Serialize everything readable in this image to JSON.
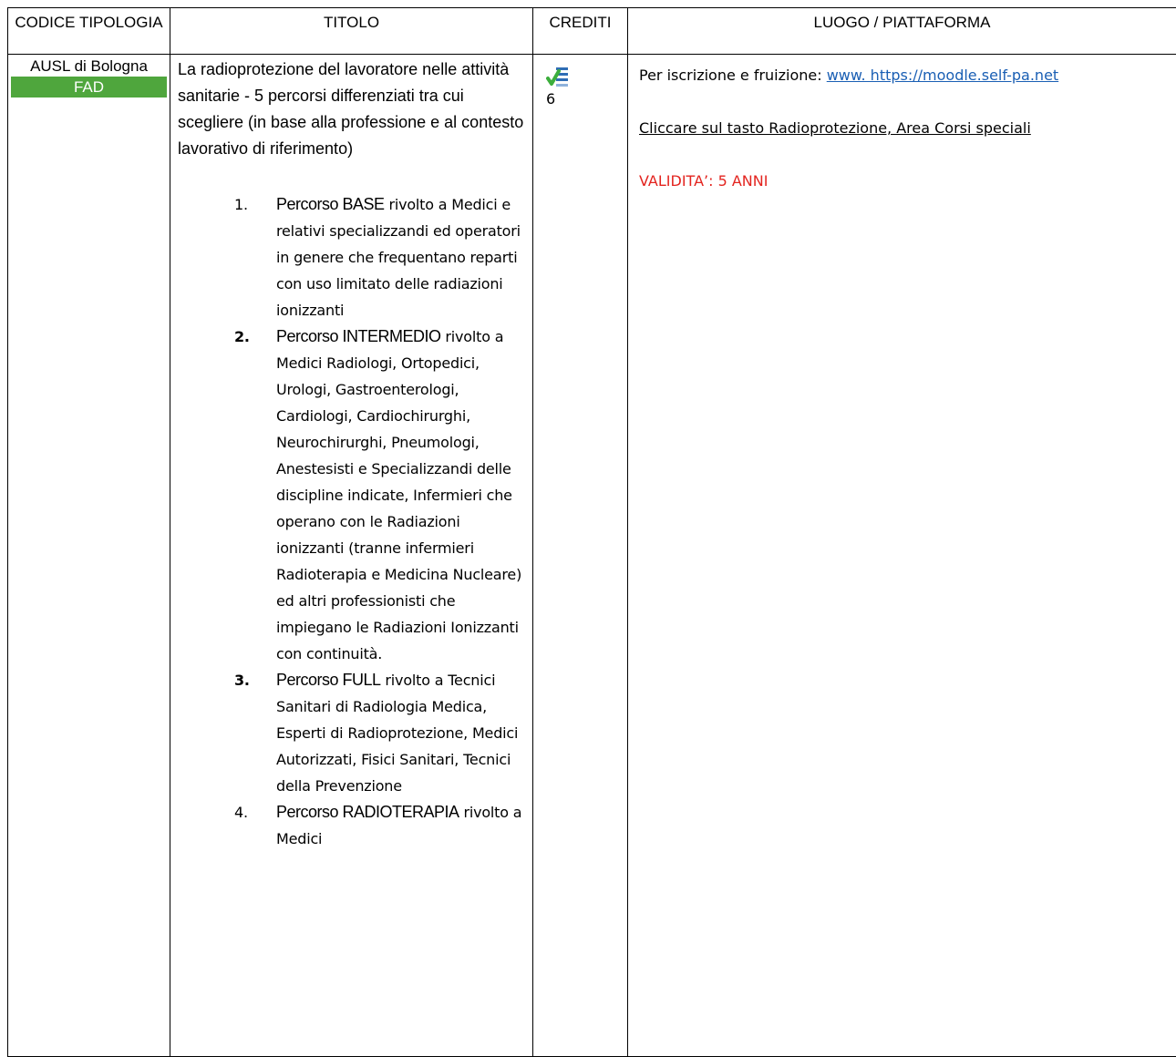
{
  "table": {
    "headers": {
      "codice_tipologia": "CODICE TIPOLOGIA",
      "titolo": "TITOLO",
      "crediti": "CREDITI",
      "luogo": "LUOGO / PIATTAFORMA"
    },
    "row": {
      "provider": "AUSL di Bologna",
      "tipologia_badge": "FAD",
      "badge_color": "#4fa63d",
      "title_intro": "La radioprotezione del lavoratore nelle attività sanitarie - 5 percorsi differenziati tra cui scegliere (in base alla professione e al contesto lavorativo di riferimento)",
      "percorsi": [
        {
          "num": "1.",
          "head": "Percorso BASE",
          "text": " rivolto a Medici e relativi specializzandi ed operatori in genere che frequentano reparti con uso limitato delle radiazioni ionizzanti"
        },
        {
          "num": "2.",
          "head": "Percorso INTERMEDIO",
          "text": " rivolto a Medici Radiologi, Ortopedici, Urologi, Gastroenterologi, Cardiologi, Cardiochirurghi, Neurochirurghi, Pneumologi, Anestesisti e Specializzandi delle discipline indicate, Infermieri che operano con le Radiazioni ionizzanti (tranne infermieri Radioterapia e Medicina Nucleare) ed altri professionisti che impiegano le Radiazioni Ionizzanti con continuità."
        },
        {
          "num": "3.",
          "head": "Percorso FULL",
          "text": " rivolto a Tecnici Sanitari di Radiologia Medica, Esperti di Radioprotezione, Medici Autorizzati, Fisici Sanitari, Tecnici della Prevenzione"
        },
        {
          "num": "4.",
          "head": "Percorso RADIOTERAPIA",
          "text": " rivolto a Medici"
        }
      ],
      "credits_icon": "checklist-icon",
      "credits": "6",
      "luogo_prefix": "Per iscrizione e fruizione: ",
      "luogo_link": "www. https://moodle.self-pa.net",
      "luogo_instructions": "Cliccare sul tasto Radioprotezione, Area Corsi speciali",
      "validita": "VALIDITA’: 5 ANNI",
      "validita_color": "#e3241f",
      "link_color": "#1a5fb4"
    }
  }
}
